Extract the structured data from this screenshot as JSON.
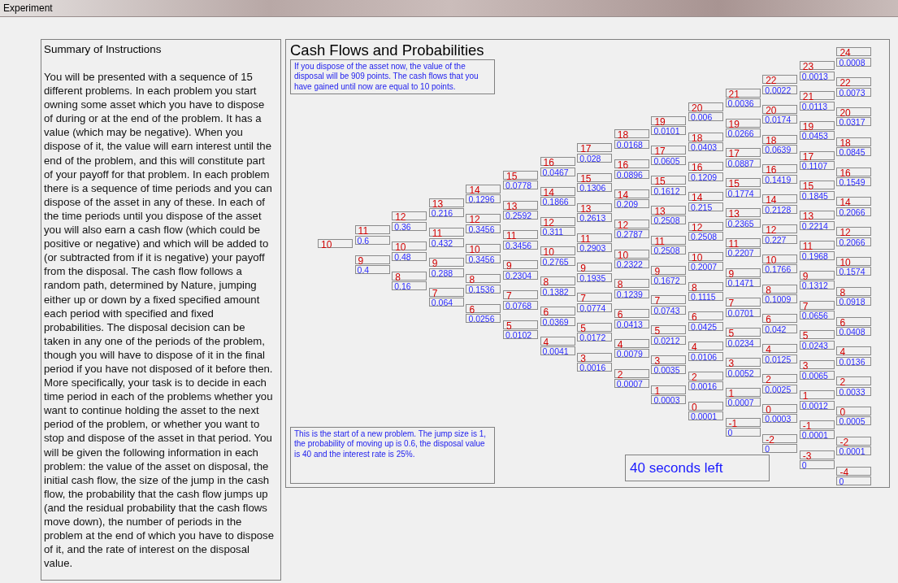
{
  "window": {
    "title": "Experiment"
  },
  "instructions": {
    "title": "Summary of Instructions",
    "text": "You will be presented with a sequence of 15 different problems. In each problem you start owning some asset which you have to dispose of during or at the end of the problem. It has a value (which may be negative). When you dispose of it, the value will earn interest until the end of the problem, and this will constitute part of your payoff for that problem. In each problem there is a sequence of time periods and you can dispose of the asset in any of these. In each of the time periods until you dispose of the asset you will also earn a cash flow (which could be positive or negative) and which will be added to (or subtracted from if it is negative) your payoff from the disposal. The cash flow follows a random path, determined by Nature, jumping either up or down by a fixed specified amount each period with specified and fixed probabilities. The disposal decision can be taken in any one of the periods of the problem, though you will have to dispose of it in the final period if you have not disposed of it before then. More specifically, your task is to decide in each time period in each of the problems whether you want to continue holding the asset to the next period of the problem, or whether you want to stop and dispose of the asset in that period. You will be given the following information in each problem: the value of the asset on disposal, the initial cash flow, the size of the jump in the cash flow, the probability that the cash flow jumps up (and the residual probability that the cash flows move down), the number of periods in the problem at the end of which you have to dispose of it, and the rate of interest on the disposal value."
  },
  "cash_flows": {
    "title": "Cash Flows and Probabilities",
    "status_message": "If you dispose of the asset now, the value of the disposal will be 909 points. The cash flows that you have gained until now are equal to 10 points.",
    "columns": [
      {
        "nodes": [
          {
            "value": "10"
          }
        ]
      },
      {
        "nodes": [
          {
            "value": "11",
            "probability": "0.6"
          },
          {
            "value": "9",
            "probability": "0.4"
          }
        ]
      },
      {
        "nodes": [
          {
            "value": "12",
            "probability": "0.36"
          },
          {
            "value": "10",
            "probability": "0.48"
          },
          {
            "value": "8",
            "probability": "0.16"
          }
        ]
      },
      {
        "nodes": [
          {
            "value": "13",
            "probability": "0.216"
          },
          {
            "value": "11",
            "probability": "0.432"
          },
          {
            "value": "9",
            "probability": "0.288"
          },
          {
            "value": "7",
            "probability": "0.064"
          }
        ]
      },
      {
        "nodes": [
          {
            "value": "14",
            "probability": "0.1296"
          },
          {
            "value": "12",
            "probability": "0.3456"
          },
          {
            "value": "10",
            "probability": "0.3456"
          },
          {
            "value": "8",
            "probability": "0.1536"
          },
          {
            "value": "6",
            "probability": "0.0256"
          }
        ]
      },
      {
        "nodes": [
          {
            "value": "15",
            "probability": "0.0778"
          },
          {
            "value": "13",
            "probability": "0.2592"
          },
          {
            "value": "11",
            "probability": "0.3456"
          },
          {
            "value": "9",
            "probability": "0.2304"
          },
          {
            "value": "7",
            "probability": "0.0768"
          },
          {
            "value": "5",
            "probability": "0.0102"
          }
        ]
      },
      {
        "nodes": [
          {
            "value": "16",
            "probability": "0.0467"
          },
          {
            "value": "14",
            "probability": "0.1866"
          },
          {
            "value": "12",
            "probability": "0.311"
          },
          {
            "value": "10",
            "probability": "0.2765"
          },
          {
            "value": "8",
            "probability": "0.1382"
          },
          {
            "value": "6",
            "probability": "0.0369"
          },
          {
            "value": "4",
            "probability": "0.0041"
          }
        ]
      },
      {
        "nodes": [
          {
            "value": "17",
            "probability": "0.028"
          },
          {
            "value": "15",
            "probability": "0.1306"
          },
          {
            "value": "13",
            "probability": "0.2613"
          },
          {
            "value": "11",
            "probability": "0.2903"
          },
          {
            "value": "9",
            "probability": "0.1935"
          },
          {
            "value": "7",
            "probability": "0.0774"
          },
          {
            "value": "5",
            "probability": "0.0172"
          },
          {
            "value": "3",
            "probability": "0.0016"
          }
        ]
      },
      {
        "nodes": [
          {
            "value": "18",
            "probability": "0.0168"
          },
          {
            "value": "16",
            "probability": "0.0896"
          },
          {
            "value": "14",
            "probability": "0.209"
          },
          {
            "value": "12",
            "probability": "0.2787"
          },
          {
            "value": "10",
            "probability": "0.2322"
          },
          {
            "value": "8",
            "probability": "0.1239"
          },
          {
            "value": "6",
            "probability": "0.0413"
          },
          {
            "value": "4",
            "probability": "0.0079"
          },
          {
            "value": "2",
            "probability": "0.0007"
          }
        ]
      },
      {
        "nodes": [
          {
            "value": "19",
            "probability": "0.0101"
          },
          {
            "value": "17",
            "probability": "0.0605"
          },
          {
            "value": "15",
            "probability": "0.1612"
          },
          {
            "value": "13",
            "probability": "0.2508"
          },
          {
            "value": "11",
            "probability": "0.2508"
          },
          {
            "value": "9",
            "probability": "0.1672"
          },
          {
            "value": "7",
            "probability": "0.0743"
          },
          {
            "value": "5",
            "probability": "0.0212"
          },
          {
            "value": "3",
            "probability": "0.0035"
          },
          {
            "value": "1",
            "probability": "0.0003"
          }
        ]
      },
      {
        "nodes": [
          {
            "value": "20",
            "probability": "0.006"
          },
          {
            "value": "18",
            "probability": "0.0403"
          },
          {
            "value": "16",
            "probability": "0.1209"
          },
          {
            "value": "14",
            "probability": "0.215"
          },
          {
            "value": "12",
            "probability": "0.2508"
          },
          {
            "value": "10",
            "probability": "0.2007"
          },
          {
            "value": "8",
            "probability": "0.1115"
          },
          {
            "value": "6",
            "probability": "0.0425"
          },
          {
            "value": "4",
            "probability": "0.0106"
          },
          {
            "value": "2",
            "probability": "0.0016"
          },
          {
            "value": "0",
            "probability": "0.0001"
          }
        ]
      },
      {
        "nodes": [
          {
            "value": "21",
            "probability": "0.0036"
          },
          {
            "value": "19",
            "probability": "0.0266"
          },
          {
            "value": "17",
            "probability": "0.0887"
          },
          {
            "value": "15",
            "probability": "0.1774"
          },
          {
            "value": "13",
            "probability": "0.2365"
          },
          {
            "value": "11",
            "probability": "0.2207"
          },
          {
            "value": "9",
            "probability": "0.1471"
          },
          {
            "value": "7",
            "probability": "0.0701"
          },
          {
            "value": "5",
            "probability": "0.0234"
          },
          {
            "value": "3",
            "probability": "0.0052"
          },
          {
            "value": "1",
            "probability": "0.0007"
          },
          {
            "value": "-1",
            "probability": "0"
          }
        ]
      },
      {
        "nodes": [
          {
            "value": "22",
            "probability": "0.0022"
          },
          {
            "value": "20",
            "probability": "0.0174"
          },
          {
            "value": "18",
            "probability": "0.0639"
          },
          {
            "value": "16",
            "probability": "0.1419"
          },
          {
            "value": "14",
            "probability": "0.2128"
          },
          {
            "value": "12",
            "probability": "0.227"
          },
          {
            "value": "10",
            "probability": "0.1766"
          },
          {
            "value": "8",
            "probability": "0.1009"
          },
          {
            "value": "6",
            "probability": "0.042"
          },
          {
            "value": "4",
            "probability": "0.0125"
          },
          {
            "value": "2",
            "probability": "0.0025"
          },
          {
            "value": "0",
            "probability": "0.0003"
          },
          {
            "value": "-2",
            "probability": "0"
          }
        ]
      },
      {
        "nodes": [
          {
            "value": "23",
            "probability": "0.0013"
          },
          {
            "value": "21",
            "probability": "0.0113"
          },
          {
            "value": "19",
            "probability": "0.0453"
          },
          {
            "value": "17",
            "probability": "0.1107"
          },
          {
            "value": "15",
            "probability": "0.1845"
          },
          {
            "value": "13",
            "probability": "0.2214"
          },
          {
            "value": "11",
            "probability": "0.1968"
          },
          {
            "value": "9",
            "probability": "0.1312"
          },
          {
            "value": "7",
            "probability": "0.0656"
          },
          {
            "value": "5",
            "probability": "0.0243"
          },
          {
            "value": "3",
            "probability": "0.0065"
          },
          {
            "value": "1",
            "probability": "0.0012"
          },
          {
            "value": "-1",
            "probability": "0.0001"
          },
          {
            "value": "-3",
            "probability": "0"
          }
        ]
      },
      {
        "nodes": [
          {
            "value": "24",
            "probability": "0.0008"
          },
          {
            "value": "22",
            "probability": "0.0073"
          },
          {
            "value": "20",
            "probability": "0.0317"
          },
          {
            "value": "18",
            "probability": "0.0845"
          },
          {
            "value": "16",
            "probability": "0.1549"
          },
          {
            "value": "14",
            "probability": "0.2066"
          },
          {
            "value": "12",
            "probability": "0.2066"
          },
          {
            "value": "10",
            "probability": "0.1574"
          },
          {
            "value": "8",
            "probability": "0.0918"
          },
          {
            "value": "6",
            "probability": "0.0408"
          },
          {
            "value": "4",
            "probability": "0.0136"
          },
          {
            "value": "2",
            "probability": "0.0033"
          },
          {
            "value": "0",
            "probability": "0.0005"
          },
          {
            "value": "-2",
            "probability": "0.0001"
          },
          {
            "value": "-4",
            "probability": "0"
          }
        ]
      }
    ],
    "problem_message": "This is the start of a new problem. The jump size is 1, the probability of moving up is 0.6, the disposal value is 40 and the interest rate is 25%.",
    "timer": "40 seconds left"
  }
}
